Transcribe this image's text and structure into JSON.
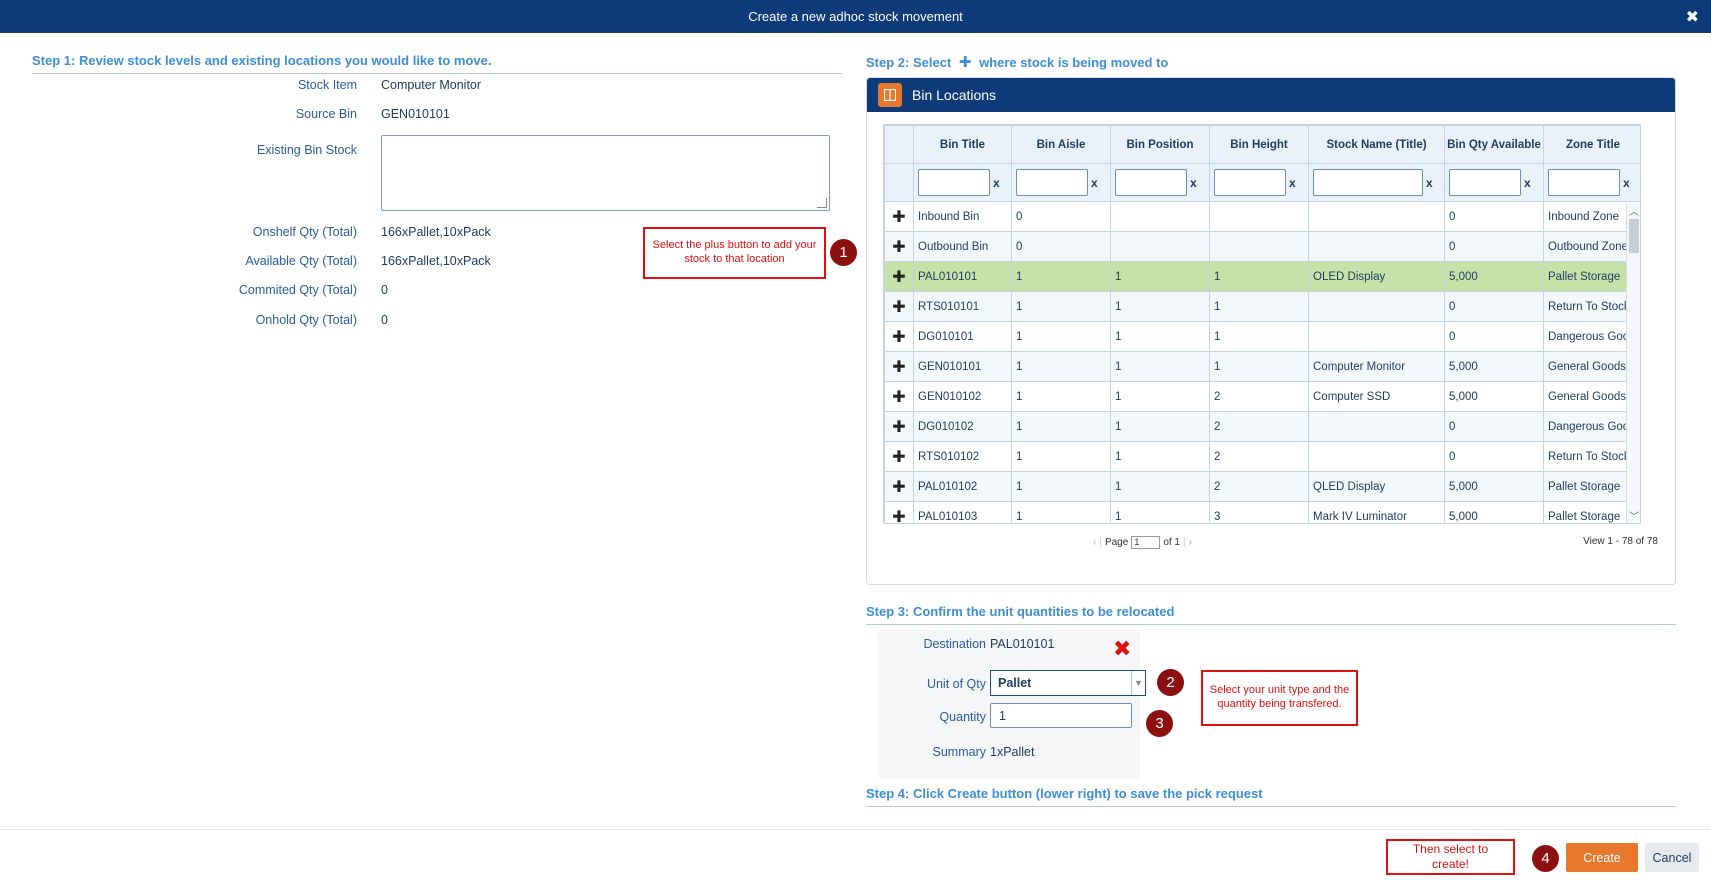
{
  "window": {
    "title": "Create a new adhoc stock movement",
    "close": "✖"
  },
  "step1": {
    "heading": "Step 1: Review stock levels and existing locations you would like to move.",
    "fields": [
      {
        "label": "Stock Item",
        "value": "Computer Monitor"
      },
      {
        "label": "Source Bin",
        "value": "GEN010101"
      },
      {
        "label": "Existing Bin Stock",
        "value": ""
      },
      {
        "label": "Onshelf Qty (Total)",
        "value": "166xPallet,10xPack"
      },
      {
        "label": "Available Qty (Total)",
        "value": "166xPallet,10xPack"
      },
      {
        "label": "Commited Qty (Total)",
        "value": "0"
      },
      {
        "label": "Onhold Qty (Total)",
        "value": "0"
      }
    ]
  },
  "callouts": {
    "c1": "Select the plus button to add your stock to that location",
    "c2": "Select your unit type and the quantity being transfered.",
    "c4": "Then select to create!",
    "b1": "1",
    "b2": "2",
    "b3": "3",
    "b4": "4"
  },
  "step2": {
    "heading_pre": "Step 2: Select",
    "plus_icon": "✚",
    "heading_post": "where stock is being moved to",
    "panel_title": "Bin Locations",
    "columns": [
      "Bin Title",
      "Bin Aisle",
      "Bin Position",
      "Bin Height",
      "Stock Name (Title)",
      "Bin Qty Available",
      "Zone Title"
    ],
    "filter_clear": "x",
    "rows": [
      [
        "Inbound Bin",
        "0",
        "",
        "",
        "",
        "0",
        "Inbound Zone"
      ],
      [
        "Outbound Bin",
        "0",
        "",
        "",
        "",
        "0",
        "Outbound Zone"
      ],
      [
        "PAL010101",
        "1",
        "1",
        "1",
        "OLED Display",
        "5,000",
        "Pallet Storage"
      ],
      [
        "RTS010101",
        "1",
        "1",
        "1",
        "",
        "0",
        "Return To Stock"
      ],
      [
        "DG010101",
        "1",
        "1",
        "1",
        "",
        "0",
        "Dangerous Goods"
      ],
      [
        "GEN010101",
        "1",
        "1",
        "1",
        "Computer Monitor",
        "5,000",
        "General Goods"
      ],
      [
        "GEN010102",
        "1",
        "1",
        "2",
        "Computer SSD",
        "5,000",
        "General Goods"
      ],
      [
        "DG010102",
        "1",
        "1",
        "2",
        "",
        "0",
        "Dangerous Goods"
      ],
      [
        "RTS010102",
        "1",
        "1",
        "2",
        "",
        "0",
        "Return To Stock"
      ],
      [
        "PAL010102",
        "1",
        "1",
        "2",
        "QLED Display",
        "5,000",
        "Pallet Storage"
      ],
      [
        "PAL010103",
        "1",
        "1",
        "3",
        "Mark IV Luminator",
        "5,000",
        "Pallet Storage"
      ]
    ],
    "selected_row": 2,
    "pager": {
      "page_label": "Page",
      "page": "1",
      "of": "of 1",
      "view": "View 1 - 78 of 78"
    }
  },
  "step3": {
    "heading": "Step 3: Confirm the unit quantities to be relocated",
    "destination_label": "Destination",
    "destination_value": "PAL010101",
    "unit_label": "Unit of Qty",
    "unit_value": "Pallet",
    "quantity_label": "Quantity",
    "quantity_value": "1",
    "summary_label": "Summary",
    "summary_value": "1xPallet"
  },
  "step4": {
    "heading": "Step 4: Click Create button (lower right) to save the pick request"
  },
  "footer": {
    "create": "Create",
    "cancel": "Cancel"
  },
  "colors": {
    "header": "#0d3a78",
    "accent": "#e8782c",
    "selected_row": "#c5e3a9",
    "callout": "#e01010",
    "badge": "#8c1010"
  }
}
